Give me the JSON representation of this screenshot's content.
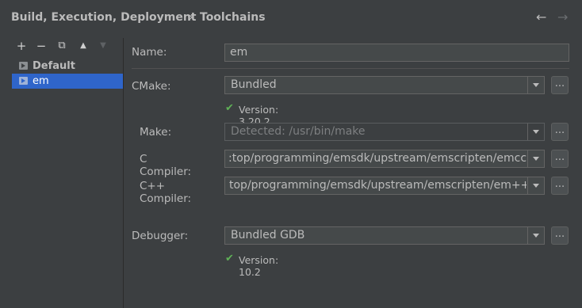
{
  "breadcrumb": {
    "parent": "Build, Execution, Deployment",
    "separator": "›",
    "current": "Toolchains"
  },
  "nav": {
    "back": "←",
    "forward": "→"
  },
  "toolbar": {
    "add": "+",
    "remove": "−",
    "copy": "⧉",
    "up": "▲",
    "down": "▼"
  },
  "toolchains": [
    {
      "label": "Default",
      "bold": true,
      "selected": false
    },
    {
      "label": "em",
      "bold": false,
      "selected": true
    }
  ],
  "form": {
    "name_label": "Name:",
    "name_value": "em",
    "cmake_label": "CMake:",
    "cmake_value": "Bundled",
    "cmake_version": "Version: 3.20.2",
    "make_label": "Make:",
    "make_placeholder": "Detected: /usr/bin/make",
    "c_compiler_label": "C Compiler:",
    "c_compiler_value": ":top/programming/emsdk/upstream/emscripten/emcc",
    "cpp_compiler_label": "C++ Compiler:",
    "cpp_compiler_value": "top/programming/emsdk/upstream/emscripten/em++",
    "debugger_label": "Debugger:",
    "debugger_value": "Bundled GDB",
    "debugger_version": "Version: 10.2",
    "browse_label": "..."
  },
  "colors": {
    "selection": "#2f65ca",
    "check": "#5fb157",
    "background": "#3c3f41"
  }
}
